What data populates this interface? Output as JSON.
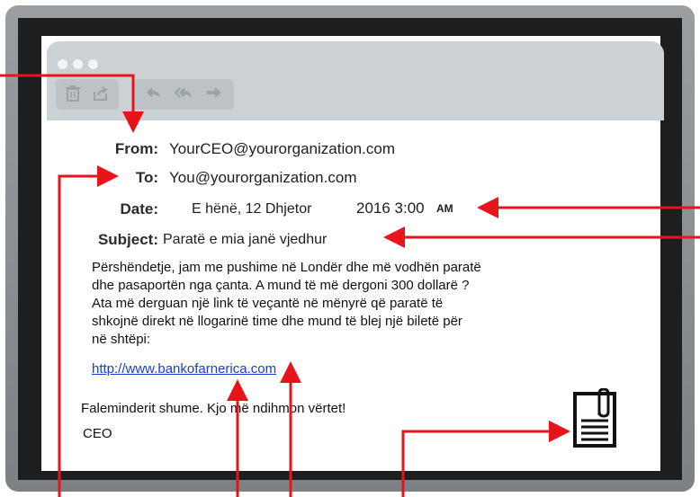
{
  "email": {
    "from_label": "From:",
    "from_value": "YourCEO@yourorganization.com",
    "to_label": "To:",
    "to_value": "You@yourorganization.com",
    "date_label": "Date:",
    "date_value": "E hënë, 12 Dhjetor",
    "date_time": "2016 3:00",
    "date_ampm": "AM",
    "subject_label": "Subject:",
    "subject_value": "Paratë e mia janë vjedhur",
    "body_lines": [
      "Përshëndetje, jam me pushime në Londër dhe më vodhën paratë",
      "dhe pasaportën nga çanta. A mund të më dergoni 300 dollarë ?",
      "Ata më derguan një link të veçantë në mënyrë që paratë të",
      "shkojnë direkt në llogarinë time dhe  mund të blej një biletë për",
      "në shtëpi:"
    ],
    "link": "http://www.bankofarnerica.com",
    "closing": "Faleminderit shume. Kjo më ndihmon vërtet!",
    "signature": "CEO"
  },
  "toolbar": {
    "icons": [
      "trash-icon",
      "share-icon",
      "reply-icon",
      "reply-all-icon",
      "forward-icon"
    ]
  },
  "colors": {
    "arrow": "#e8141c",
    "titlebar": "#ccd1d3",
    "bezel": "#8a8e91",
    "screen_frame": "#1e1e1e",
    "link": "#1a3ec8"
  }
}
